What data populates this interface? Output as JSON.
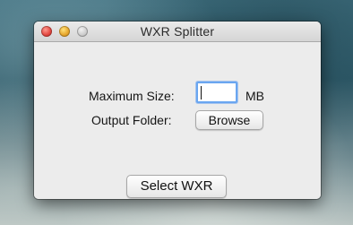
{
  "window": {
    "title": "WXR Splitter"
  },
  "form": {
    "max_size_label": "Maximum Size:",
    "max_size_value": "",
    "unit_label": "MB",
    "output_folder_label": "Output Folder:",
    "browse_label": "Browse"
  },
  "actions": {
    "select_label": "Select WXR"
  },
  "colors": {
    "focus_ring": "#6aa6f0",
    "close_button": "#e2463f",
    "minimize_button": "#e6a52a",
    "zoom_button": "#c9c9c9"
  }
}
